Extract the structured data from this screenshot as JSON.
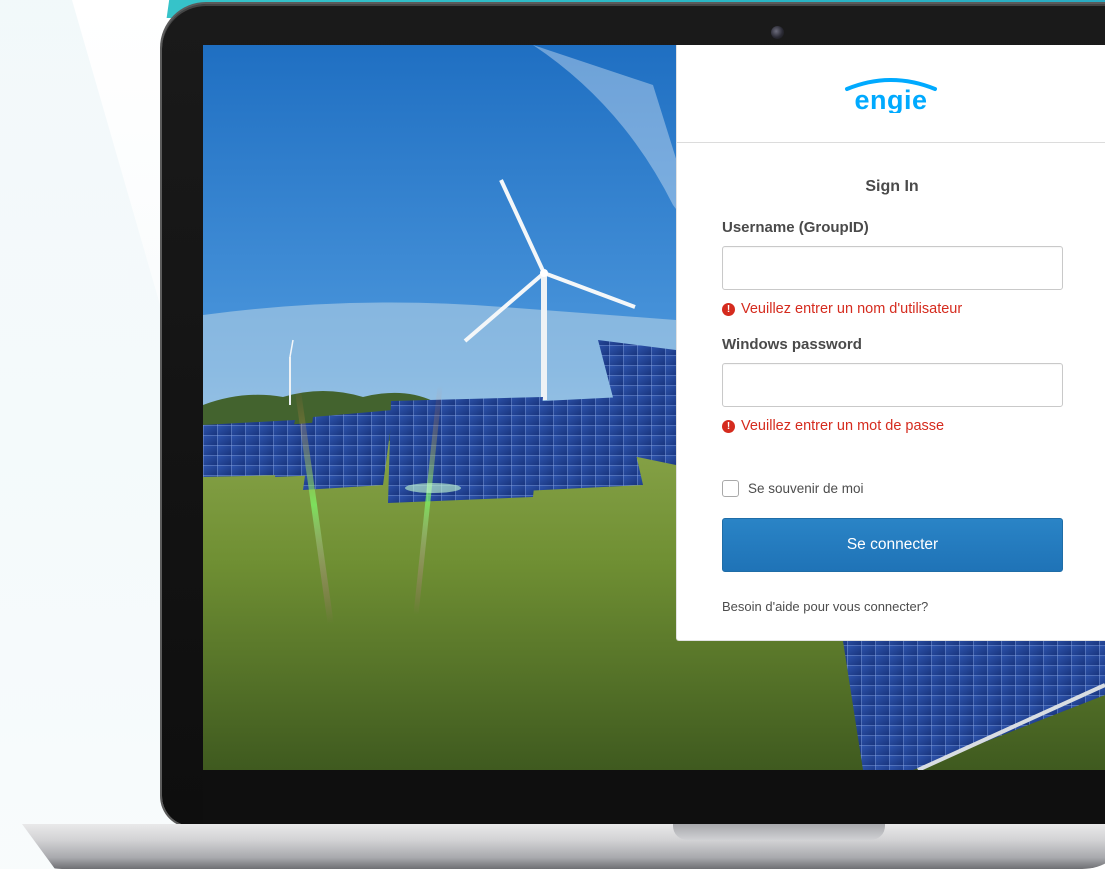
{
  "brand": {
    "logo_text": "engie",
    "logo_color": "#00aaff"
  },
  "login": {
    "title": "Sign In",
    "username": {
      "label": "Username (GroupID)",
      "value": "",
      "error": "Veuillez entrer un nom d'utilisateur"
    },
    "password": {
      "label": "Windows password",
      "value": "",
      "error": "Veuillez entrer un mot de passe"
    },
    "remember_label": "Se souvenir de moi",
    "submit_label": "Se connecter",
    "help_link": "Besoin d'aide pour vous connecter?"
  },
  "colors": {
    "error": "#d52b1e",
    "primary_button": "#1f73b7",
    "accent_band": "#2fb9c6"
  },
  "icons": [
    "error-icon",
    "checkbox-icon"
  ]
}
